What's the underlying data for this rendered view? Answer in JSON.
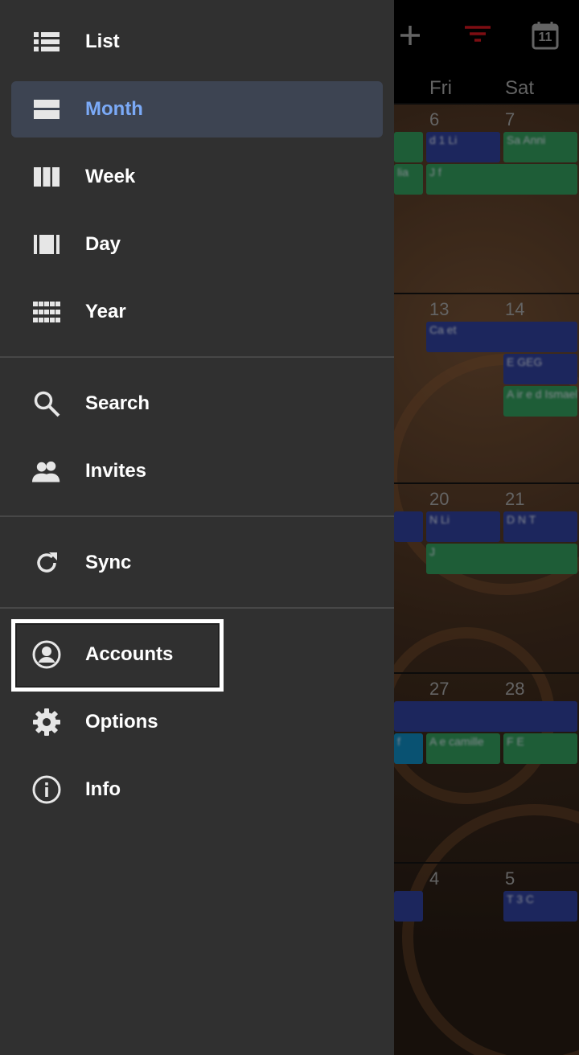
{
  "calendar": {
    "toolbar_icons": [
      "add-icon",
      "filter-icon",
      "today-calendar-icon"
    ],
    "today_number": "11",
    "filter_color": "#c0141c",
    "day_headers": [
      "Fri",
      "Sat"
    ],
    "weeks": [
      {
        "fri": "6",
        "sat": "7",
        "events": [
          "d 1 Li",
          "Sa Anni",
          "lia",
          "J f"
        ]
      },
      {
        "fri": "13",
        "sat": "14",
        "events": [
          "Ca et",
          "E GEG",
          "A ir e d Ismael"
        ]
      },
      {
        "fri": "20",
        "sat": "21",
        "events": [
          "N Li",
          "D N T",
          "J"
        ]
      },
      {
        "fri": "27",
        "sat": "28",
        "events": [
          "f",
          "A e camille",
          "F E"
        ]
      },
      {
        "fri": "4",
        "sat": "5",
        "events": [
          "T 3 C"
        ]
      }
    ]
  },
  "drawer": {
    "view_items": [
      {
        "label": "List",
        "icon": "list-icon"
      },
      {
        "label": "Month",
        "icon": "month-view-icon",
        "active": true
      },
      {
        "label": "Week",
        "icon": "week-view-icon"
      },
      {
        "label": "Day",
        "icon": "day-view-icon"
      },
      {
        "label": "Year",
        "icon": "year-view-icon"
      }
    ],
    "tool_items": [
      {
        "label": "Search",
        "icon": "search-icon"
      },
      {
        "label": "Invites",
        "icon": "people-icon"
      }
    ],
    "sync_items": [
      {
        "label": "Sync",
        "icon": "sync-icon"
      }
    ],
    "settings_items": [
      {
        "label": "Accounts",
        "icon": "account-circle-icon"
      },
      {
        "label": "Options",
        "icon": "gear-icon"
      },
      {
        "label": "Info",
        "icon": "info-icon"
      }
    ],
    "active_color": "#7baaf7"
  }
}
